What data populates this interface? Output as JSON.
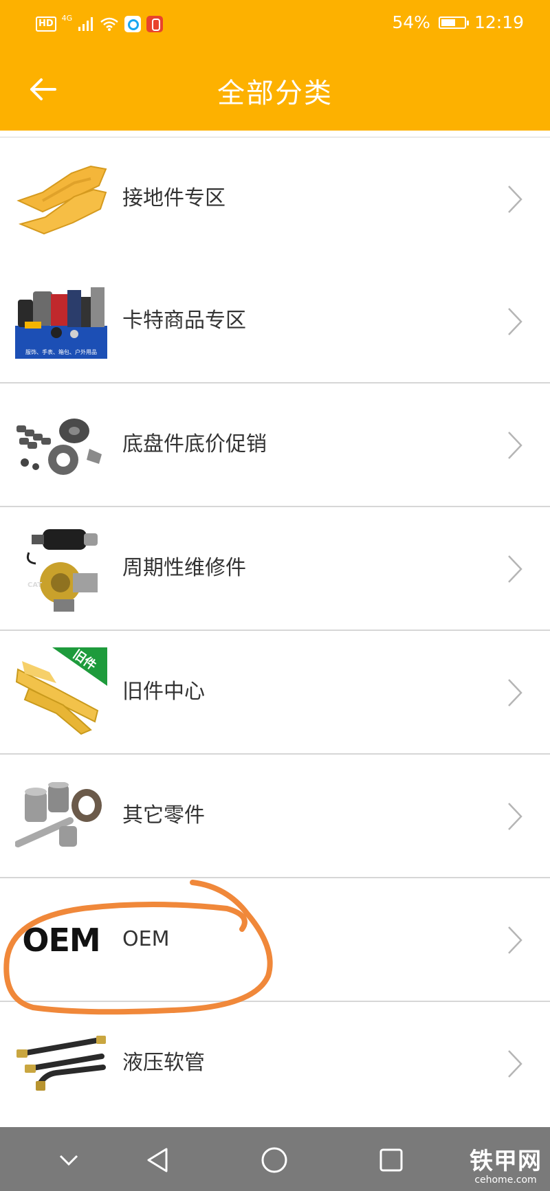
{
  "status_bar": {
    "hd": "HD",
    "network": "4G",
    "battery_percent": "54%",
    "time": "12:19"
  },
  "header": {
    "title": "全部分类",
    "background": "#FDB100"
  },
  "categories": [
    {
      "label": "接地件专区",
      "thumb_icon": "bucket-teeth-image"
    },
    {
      "label": "卡特商品专区",
      "thumb_icon": "cat-merchandise-image",
      "thumb_caption": "服饰、手表、箱包、户外用品"
    },
    {
      "label": "底盘件底价促销",
      "thumb_icon": "undercarriage-parts-image"
    },
    {
      "label": "周期性维修件",
      "thumb_icon": "starter-turbo-image"
    },
    {
      "label": "旧件中心",
      "thumb_icon": "used-parts-image",
      "thumb_badge": "旧件"
    },
    {
      "label": "其它零件",
      "thumb_icon": "bushings-pins-image"
    },
    {
      "label": "OEM",
      "thumb_icon": "oem-logo",
      "thumb_text": "OEM"
    },
    {
      "label": "液压软管",
      "thumb_icon": "hydraulic-hoses-image"
    }
  ],
  "annotation": {
    "color": "#F0883A"
  },
  "watermark": {
    "cn": "铁甲网",
    "en": "cehome.com"
  }
}
